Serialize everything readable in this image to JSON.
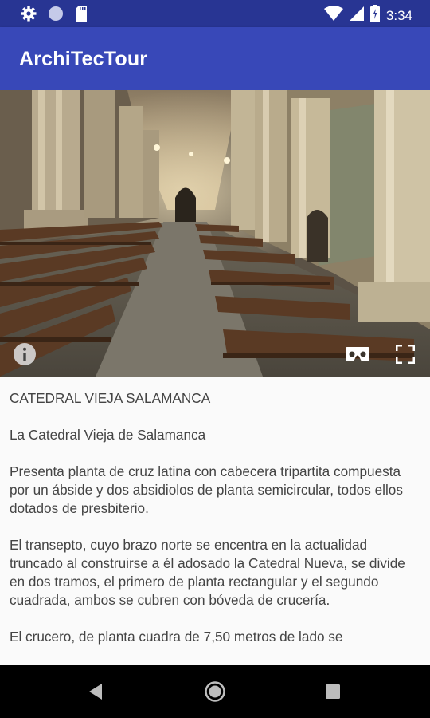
{
  "status_bar": {
    "time": "3:34",
    "icons": [
      "settings-icon",
      "circle-icon",
      "sd-card-icon",
      "wifi-icon",
      "signal-icon",
      "battery-icon"
    ]
  },
  "app_bar": {
    "title": "ArchiTecTour"
  },
  "panorama": {
    "controls": [
      "info-icon",
      "cardboard-vr-icon",
      "fullscreen-icon"
    ]
  },
  "content": {
    "heading": "CATEDRAL VIEJA SALAMANCA",
    "subtitle": "La Catedral Vieja de Salamanca",
    "paragraphs": [
      "Presenta planta de cruz latina con cabecera tripartita compuesta por un ábside y dos absidiolos de planta semicircular, todos ellos dotados de presbiterio.",
      "El transepto, cuyo brazo norte se encentra en la actualidad truncado al construirse a él adosado la Catedral Nueva, se divide en dos tramos, el primero de planta rectangular y el segundo cuadrada, ambos se cubren con bóveda de crucería.",
      "El crucero, de planta cuadra de 7,50 metros de lado se"
    ]
  },
  "nav_bar": {
    "buttons": [
      "back-icon",
      "home-icon",
      "recents-icon"
    ]
  },
  "colors": {
    "status_bar": "#283593",
    "app_bar": "#3848b8",
    "content_bg": "#fafafa",
    "text": "#444444"
  }
}
